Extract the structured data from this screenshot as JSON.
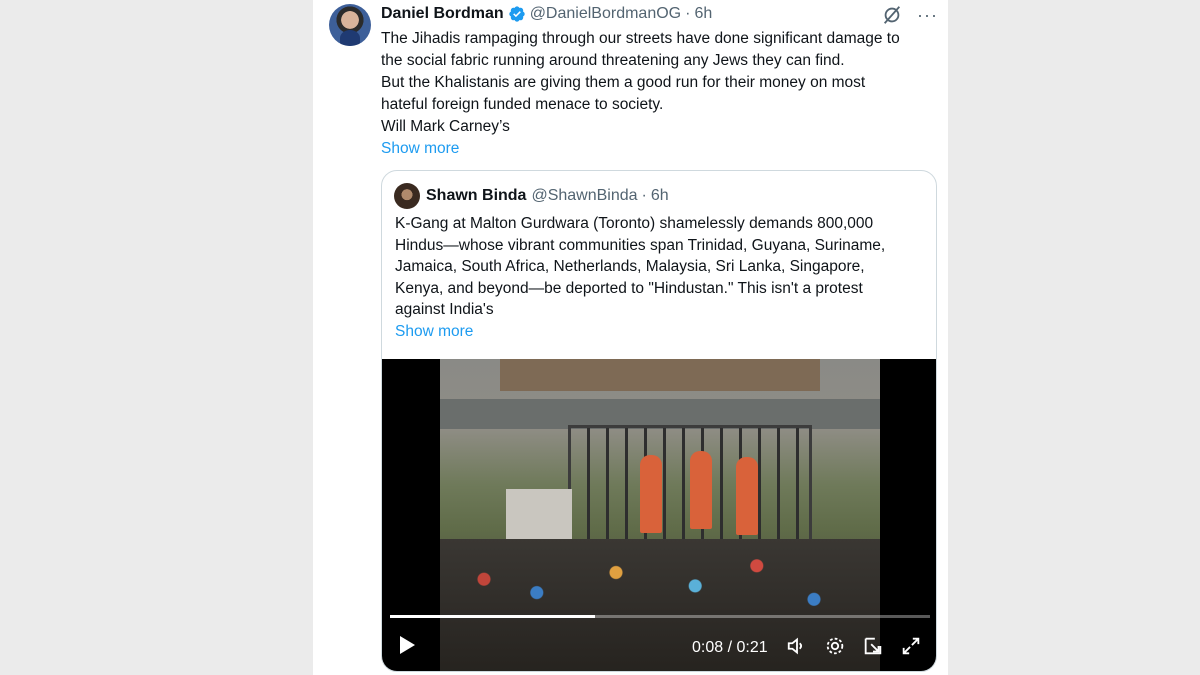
{
  "tweet": {
    "author_name": "Daniel Bordman",
    "handle": "@DanielBordmanOG",
    "separator": "·",
    "time": "6h",
    "more_glyph": "···",
    "lines": [
      "The Jihadis rampaging through our streets have done significant damage to",
      "the social fabric running around threatening any Jews they can find.",
      "But the Khalistanis are giving them a good run for their money on most",
      "hateful foreign funded menace to society.",
      "Will Mark Carney’s"
    ],
    "show_more": "Show more"
  },
  "quote": {
    "author_name": "Shawn Binda",
    "handle": "@ShawnBinda",
    "separator": "·",
    "time": "6h",
    "lines": [
      "K-Gang at Malton Gurdwara (Toronto) shamelessly demands 800,000",
      "Hindus—whose vibrant communities span Trinidad, Guyana, Suriname,",
      "Jamaica, South Africa, Netherlands, Malaysia, Sri Lanka, Singapore,",
      "Kenya, and beyond—be deported to \"Hindustan.\" This isn't a protest",
      "against India's"
    ],
    "show_more": "Show more"
  },
  "video": {
    "time_readout": "0:08 / 0:21",
    "progress": 0.38
  },
  "icons": {
    "verified": "verified-badge-icon",
    "grok": "grok-icon",
    "more": "more-icon",
    "play": "play-icon",
    "volume": "volume-icon",
    "settings": "settings-icon",
    "pip": "picture-in-picture-icon",
    "fullscreen": "fullscreen-icon"
  },
  "colors": {
    "accent": "#1d9bf0",
    "text": "#0f1419",
    "muted": "#536471",
    "border": "#cfd9de"
  }
}
